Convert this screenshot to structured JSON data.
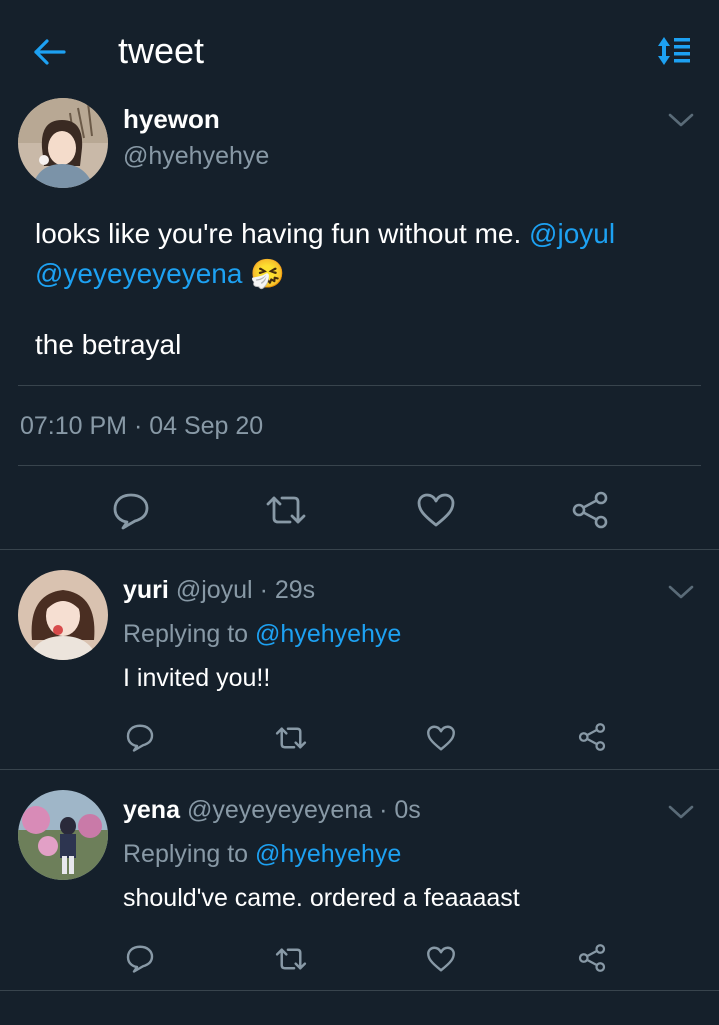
{
  "header": {
    "title": "tweet",
    "back_icon": "arrow-left-icon",
    "sort_icon": "sort-icon",
    "accent": "#1da1f2"
  },
  "main_tweet": {
    "display_name": "hyewon",
    "handle": "@hyehyehye",
    "text_before": "looks like you're having fun without me. ",
    "mention_1": "@joyul",
    "mention_2": "@yeyeyeyeyena",
    "emoji": "🤧",
    "text_second": "the betrayal",
    "timestamp": "07:10 PM · 04 Sep 20"
  },
  "replies": [
    {
      "display_name": "yuri",
      "handle": "@joyul",
      "age": "· 29s",
      "replying_label": "Replying to",
      "replying_handle": "@hyehyehye",
      "text": "I invited you!!"
    },
    {
      "display_name": "yena",
      "handle": "@yeyeyeyeyena",
      "age": "· 0s",
      "replying_label": "Replying to",
      "replying_handle": "@hyehyehye",
      "text": "should've came. ordered a feaaaast"
    }
  ],
  "colors": {
    "background": "#15202b",
    "divider": "#38444d",
    "secondary_text": "#8899a6",
    "link": "#1da1f2"
  }
}
